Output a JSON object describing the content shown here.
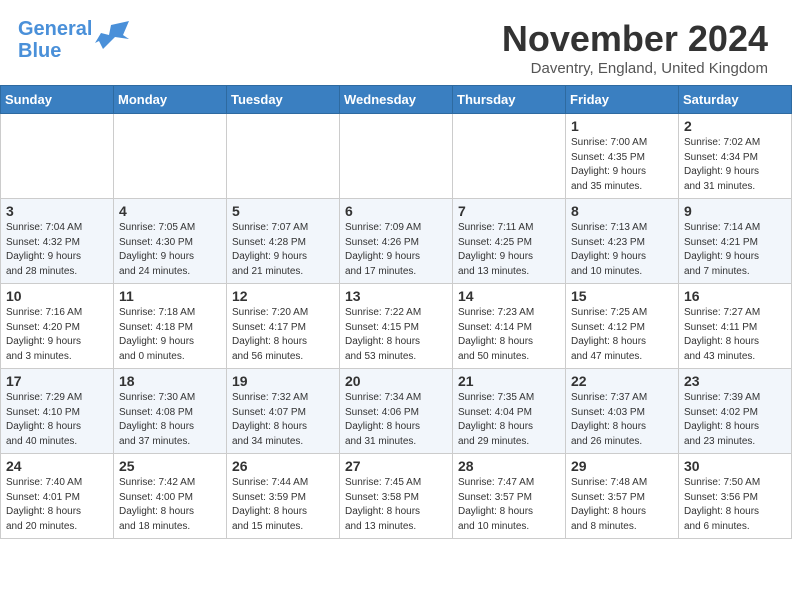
{
  "header": {
    "logo_line1": "General",
    "logo_line2": "Blue",
    "title": "November 2024",
    "location": "Daventry, England, United Kingdom"
  },
  "weekdays": [
    "Sunday",
    "Monday",
    "Tuesday",
    "Wednesday",
    "Thursday",
    "Friday",
    "Saturday"
  ],
  "weeks": [
    [
      {
        "day": "",
        "info": ""
      },
      {
        "day": "",
        "info": ""
      },
      {
        "day": "",
        "info": ""
      },
      {
        "day": "",
        "info": ""
      },
      {
        "day": "",
        "info": ""
      },
      {
        "day": "1",
        "info": "Sunrise: 7:00 AM\nSunset: 4:35 PM\nDaylight: 9 hours\nand 35 minutes."
      },
      {
        "day": "2",
        "info": "Sunrise: 7:02 AM\nSunset: 4:34 PM\nDaylight: 9 hours\nand 31 minutes."
      }
    ],
    [
      {
        "day": "3",
        "info": "Sunrise: 7:04 AM\nSunset: 4:32 PM\nDaylight: 9 hours\nand 28 minutes."
      },
      {
        "day": "4",
        "info": "Sunrise: 7:05 AM\nSunset: 4:30 PM\nDaylight: 9 hours\nand 24 minutes."
      },
      {
        "day": "5",
        "info": "Sunrise: 7:07 AM\nSunset: 4:28 PM\nDaylight: 9 hours\nand 21 minutes."
      },
      {
        "day": "6",
        "info": "Sunrise: 7:09 AM\nSunset: 4:26 PM\nDaylight: 9 hours\nand 17 minutes."
      },
      {
        "day": "7",
        "info": "Sunrise: 7:11 AM\nSunset: 4:25 PM\nDaylight: 9 hours\nand 13 minutes."
      },
      {
        "day": "8",
        "info": "Sunrise: 7:13 AM\nSunset: 4:23 PM\nDaylight: 9 hours\nand 10 minutes."
      },
      {
        "day": "9",
        "info": "Sunrise: 7:14 AM\nSunset: 4:21 PM\nDaylight: 9 hours\nand 7 minutes."
      }
    ],
    [
      {
        "day": "10",
        "info": "Sunrise: 7:16 AM\nSunset: 4:20 PM\nDaylight: 9 hours\nand 3 minutes."
      },
      {
        "day": "11",
        "info": "Sunrise: 7:18 AM\nSunset: 4:18 PM\nDaylight: 9 hours\nand 0 minutes."
      },
      {
        "day": "12",
        "info": "Sunrise: 7:20 AM\nSunset: 4:17 PM\nDaylight: 8 hours\nand 56 minutes."
      },
      {
        "day": "13",
        "info": "Sunrise: 7:22 AM\nSunset: 4:15 PM\nDaylight: 8 hours\nand 53 minutes."
      },
      {
        "day": "14",
        "info": "Sunrise: 7:23 AM\nSunset: 4:14 PM\nDaylight: 8 hours\nand 50 minutes."
      },
      {
        "day": "15",
        "info": "Sunrise: 7:25 AM\nSunset: 4:12 PM\nDaylight: 8 hours\nand 47 minutes."
      },
      {
        "day": "16",
        "info": "Sunrise: 7:27 AM\nSunset: 4:11 PM\nDaylight: 8 hours\nand 43 minutes."
      }
    ],
    [
      {
        "day": "17",
        "info": "Sunrise: 7:29 AM\nSunset: 4:10 PM\nDaylight: 8 hours\nand 40 minutes."
      },
      {
        "day": "18",
        "info": "Sunrise: 7:30 AM\nSunset: 4:08 PM\nDaylight: 8 hours\nand 37 minutes."
      },
      {
        "day": "19",
        "info": "Sunrise: 7:32 AM\nSunset: 4:07 PM\nDaylight: 8 hours\nand 34 minutes."
      },
      {
        "day": "20",
        "info": "Sunrise: 7:34 AM\nSunset: 4:06 PM\nDaylight: 8 hours\nand 31 minutes."
      },
      {
        "day": "21",
        "info": "Sunrise: 7:35 AM\nSunset: 4:04 PM\nDaylight: 8 hours\nand 29 minutes."
      },
      {
        "day": "22",
        "info": "Sunrise: 7:37 AM\nSunset: 4:03 PM\nDaylight: 8 hours\nand 26 minutes."
      },
      {
        "day": "23",
        "info": "Sunrise: 7:39 AM\nSunset: 4:02 PM\nDaylight: 8 hours\nand 23 minutes."
      }
    ],
    [
      {
        "day": "24",
        "info": "Sunrise: 7:40 AM\nSunset: 4:01 PM\nDaylight: 8 hours\nand 20 minutes."
      },
      {
        "day": "25",
        "info": "Sunrise: 7:42 AM\nSunset: 4:00 PM\nDaylight: 8 hours\nand 18 minutes."
      },
      {
        "day": "26",
        "info": "Sunrise: 7:44 AM\nSunset: 3:59 PM\nDaylight: 8 hours\nand 15 minutes."
      },
      {
        "day": "27",
        "info": "Sunrise: 7:45 AM\nSunset: 3:58 PM\nDaylight: 8 hours\nand 13 minutes."
      },
      {
        "day": "28",
        "info": "Sunrise: 7:47 AM\nSunset: 3:57 PM\nDaylight: 8 hours\nand 10 minutes."
      },
      {
        "day": "29",
        "info": "Sunrise: 7:48 AM\nSunset: 3:57 PM\nDaylight: 8 hours\nand 8 minutes."
      },
      {
        "day": "30",
        "info": "Sunrise: 7:50 AM\nSunset: 3:56 PM\nDaylight: 8 hours\nand 6 minutes."
      }
    ]
  ]
}
